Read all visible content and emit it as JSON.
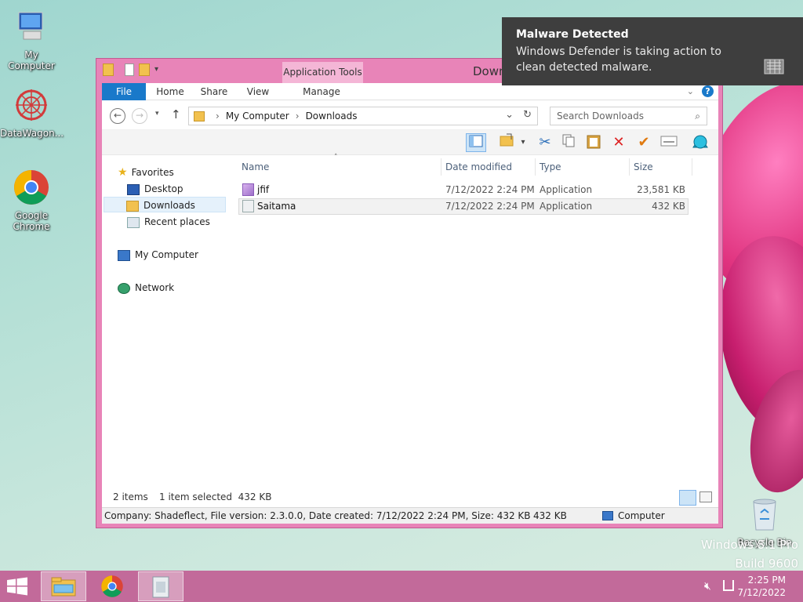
{
  "desktop": {
    "icons": [
      {
        "label": "My Computer"
      },
      {
        "label": "DataWagon..."
      },
      {
        "label": "Google Chrome"
      },
      {
        "label": "Recycle Bin"
      }
    ],
    "watermark_line1": "Windows 8.1 Pro",
    "watermark_line2": "Build 9600"
  },
  "window": {
    "title": "Downloads",
    "context_tab": "Application Tools",
    "tabs": [
      "File",
      "Home",
      "Share",
      "View",
      "Manage"
    ]
  },
  "address": {
    "crumbs": [
      "My Computer",
      "Downloads"
    ],
    "search_placeholder": "Search Downloads"
  },
  "nav": {
    "favorites": "Favorites",
    "items": [
      "Desktop",
      "Downloads",
      "Recent places"
    ],
    "my_computer": "My Computer",
    "network": "Network"
  },
  "columns": {
    "name": "Name",
    "date": "Date modified",
    "type": "Type",
    "size": "Size"
  },
  "files": [
    {
      "name": "jfif",
      "date": "7/12/2022 2:24 PM",
      "type": "Application",
      "size": "23,581 KB"
    },
    {
      "name": "Saitama",
      "date": "7/12/2022 2:24 PM",
      "type": "Application",
      "size": "432 KB"
    }
  ],
  "status": {
    "items": "2 items",
    "selected": "1 item selected  432 KB"
  },
  "details": {
    "info": "Company: Shadeflect, File version: 2.3.0.0, Date created: 7/12/2022 2:24 PM, Size: 432 KB",
    "size": "432 KB",
    "location": "Computer"
  },
  "toast": {
    "title": "Malware Detected",
    "message": "Windows Defender is taking action to clean detected malware."
  },
  "clock": {
    "time": "2:25 PM",
    "date": "7/12/2022"
  },
  "colors": {
    "accent": "#1979ca",
    "window_frame": "#e884b8",
    "taskbar": "#c26a9a",
    "toast_bg": "#3e3e3e"
  }
}
